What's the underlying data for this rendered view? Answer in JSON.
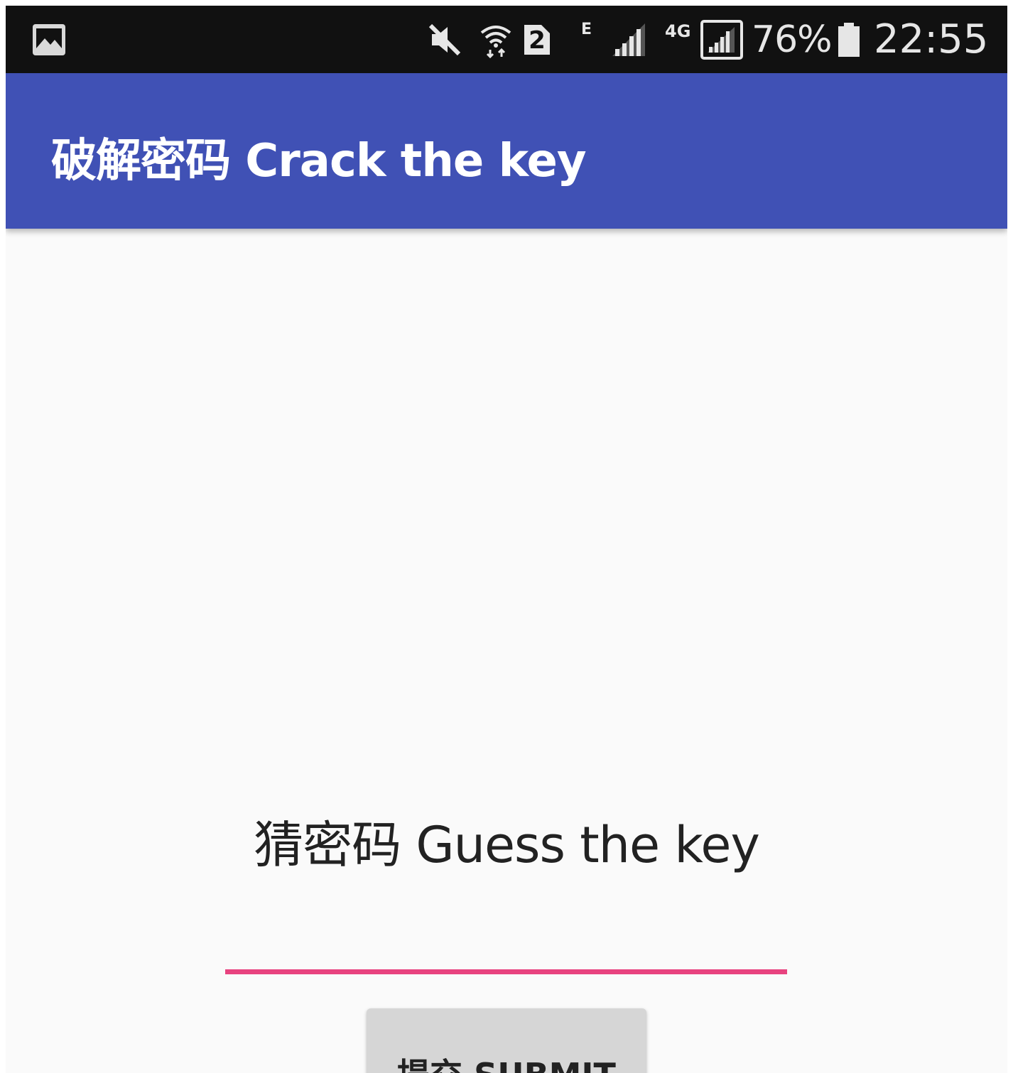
{
  "status_bar": {
    "icons": [
      "gallery-icon",
      "mute-icon",
      "wifi-icon",
      "sim-2-icon",
      "signal-icon",
      "signal-4g-icon",
      "battery-icon"
    ],
    "network_e": "E",
    "network_4g": "4G",
    "sim_number": "2",
    "battery_percent": "76%",
    "time": "22:55"
  },
  "app_bar": {
    "title": "破解密码 Crack the key",
    "background": "#4051b5"
  },
  "main": {
    "prompt": "猜密码 Guess the key",
    "key_input": {
      "value": "",
      "placeholder": "",
      "underline_color": "#e8437f"
    },
    "submit_label": "提交 SUBMIT"
  }
}
